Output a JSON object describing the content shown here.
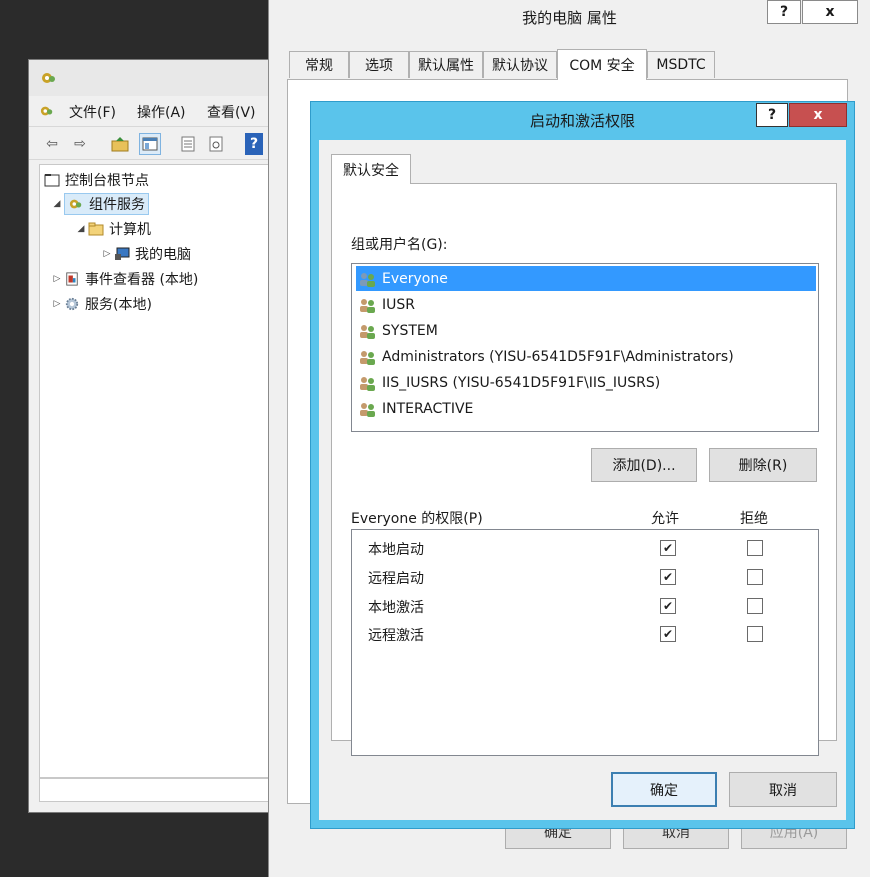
{
  "mmc": {
    "menu": [
      "文件(F)",
      "操作(A)",
      "查看(V)"
    ],
    "tree": {
      "root": "控制台根节点",
      "component_services": "组件服务",
      "computers": "计算机",
      "my_computer": "我的电脑",
      "event_viewer": "事件查看器 (本地)",
      "services": "服务(本地)"
    }
  },
  "props": {
    "title": "我的电脑 属性",
    "help": "?",
    "close": "x",
    "tabs": [
      "常规",
      "选项",
      "默认属性",
      "默认协议",
      "COM 安全",
      "MSDTC"
    ],
    "active_tab": "COM 安全",
    "ok": "确定",
    "cancel": "取消",
    "apply": "应用(A)"
  },
  "dialog": {
    "title": "启动和激活权限",
    "help": "?",
    "close": "x",
    "tab": "默认安全",
    "group_label": "组或用户名(G):",
    "users": [
      "Everyone",
      "IUSR",
      "SYSTEM",
      "Administrators (YISU-6541D5F91F\\Administrators)",
      "IIS_IUSRS (YISU-6541D5F91F\\IIS_IUSRS)",
      "INTERACTIVE"
    ],
    "selected_user": "Everyone",
    "add": "添加(D)...",
    "remove": "删除(R)",
    "perm_label": "Everyone 的权限(P)",
    "allow": "允许",
    "deny": "拒绝",
    "permissions": [
      {
        "name": "本地启动",
        "allow": true,
        "deny": false
      },
      {
        "name": "远程启动",
        "allow": true,
        "deny": false
      },
      {
        "name": "本地激活",
        "allow": true,
        "deny": false
      },
      {
        "name": "远程激活",
        "allow": true,
        "deny": false
      }
    ],
    "ok": "确定",
    "cancel": "取消"
  },
  "colors": {
    "dialog_frame": "#5ac4eb",
    "close_red": "#c75050",
    "selection": "#3399ff"
  }
}
